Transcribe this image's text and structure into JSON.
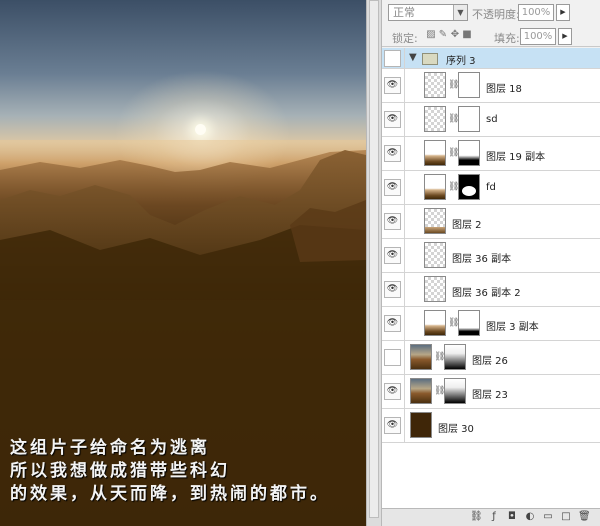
{
  "artwork": {
    "caption_lines": [
      "这组片子给命名为逃离",
      "所以我想做成猎带些科幻",
      "的效果，从天而降，到热闹的都市。"
    ]
  },
  "layers_panel": {
    "blend_mode": "正常",
    "opacity_label": "不透明度:",
    "opacity_value": "100%",
    "lock_label": "锁定:",
    "fill_label": "填充:",
    "fill_value": "100%",
    "layers": [
      {
        "name": "序列 3",
        "type": "group",
        "visible": false,
        "selected": true
      },
      {
        "name": "图层 18",
        "indented": true,
        "visible": true,
        "thumb": "checker",
        "mask": "white"
      },
      {
        "name": "sd",
        "indented": true,
        "visible": true,
        "thumb": "checker",
        "mask": "white"
      },
      {
        "name": "图层 19 副本",
        "indented": true,
        "visible": true,
        "thumb": "photo-bottom",
        "mask": "white-black-bottom"
      },
      {
        "name": "fd",
        "indented": true,
        "visible": true,
        "thumb": "photo-bottom",
        "mask": "black-white-blob"
      },
      {
        "name": "图层 2",
        "indented": true,
        "visible": true,
        "thumb": "checker-bottom"
      },
      {
        "name": "图层 36 副本",
        "indented": true,
        "visible": true,
        "thumb": "checker"
      },
      {
        "name": "图层 36 副本 2",
        "indented": true,
        "visible": true,
        "thumb": "checker"
      },
      {
        "name": "图层 3 副本",
        "indented": true,
        "visible": true,
        "thumb": "photo-bottom",
        "mask": "white-black-bottom"
      },
      {
        "name": "图层 26",
        "indented": false,
        "visible": false,
        "thumb": "photo",
        "mask": "grad"
      },
      {
        "name": "图层 23",
        "indented": false,
        "visible": true,
        "thumb": "photo",
        "mask": "grad"
      },
      {
        "name": "图层 30",
        "indented": false,
        "visible": true,
        "thumb": "dark"
      }
    ]
  }
}
